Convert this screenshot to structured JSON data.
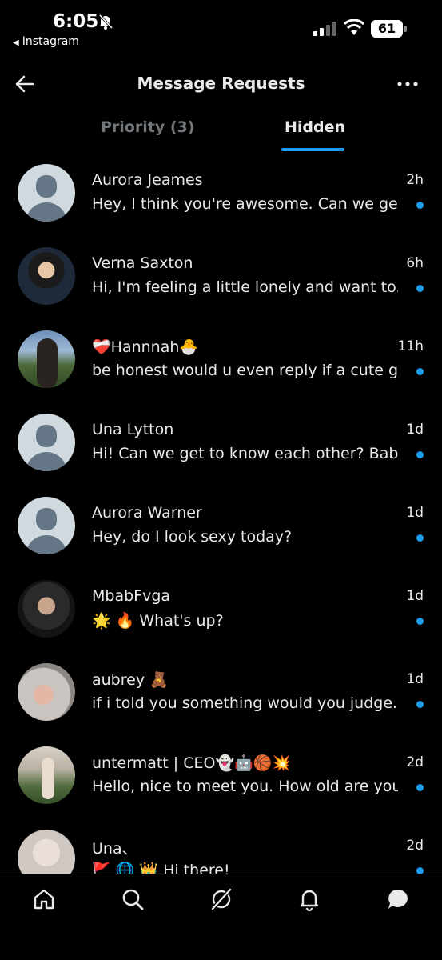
{
  "status_bar": {
    "time": "6:05",
    "back_app": "Instagram",
    "battery": "61"
  },
  "header": {
    "title": "Message Requests"
  },
  "tabs": [
    {
      "label": "Priority (3)",
      "active": false
    },
    {
      "label": "Hidden",
      "active": true
    }
  ],
  "conversations": [
    {
      "name": "Aurora Jeames",
      "time": "2h",
      "message": "Hey, I think you're awesome. Can we ge...",
      "avatar": "default",
      "unread": true
    },
    {
      "name": "Verna Saxton",
      "time": "6h",
      "message": "Hi, I'm feeling a little lonely and want to...",
      "avatar": "photo",
      "unread": true
    },
    {
      "name": "❤️‍🩹Hannnah🐣",
      "time": "11h",
      "message": "be honest would u even reply if a cute g...",
      "avatar": "photo",
      "unread": true
    },
    {
      "name": "Una Lytton",
      "time": "1d",
      "message": "Hi! Can we get to know each other? Baby",
      "avatar": "default",
      "unread": true
    },
    {
      "name": "Aurora Warner",
      "time": "1d",
      "message": "Hey, do I look sexy today?",
      "avatar": "default",
      "unread": true
    },
    {
      "name": "MbabFvga",
      "time": "1d",
      "message": "🌟 🔥 What's up?",
      "avatar": "photo",
      "unread": true
    },
    {
      "name": "aubrey 🧸",
      "time": "1d",
      "message": "if i told you something would you judge...",
      "avatar": "photo",
      "unread": true
    },
    {
      "name": "untermatt | CEO👻🤖🏀💥",
      "time": "2d",
      "message": "Hello, nice to meet you. How old are you?",
      "avatar": "photo",
      "unread": true
    },
    {
      "name": "Una、",
      "time": "2d",
      "message": "🚩 🌐 👑 Hi there!",
      "avatar": "photo",
      "unread": true
    }
  ],
  "colors": {
    "background": "#000000",
    "accent": "#1d9bf0",
    "text": "#e7e9ea",
    "muted": "#71767b"
  },
  "icons": {
    "header_left": "back-arrow-icon",
    "header_right": "more-icon",
    "nav": [
      "home-icon",
      "search-icon",
      "grok-icon",
      "notifications-icon",
      "messages-icon"
    ]
  }
}
